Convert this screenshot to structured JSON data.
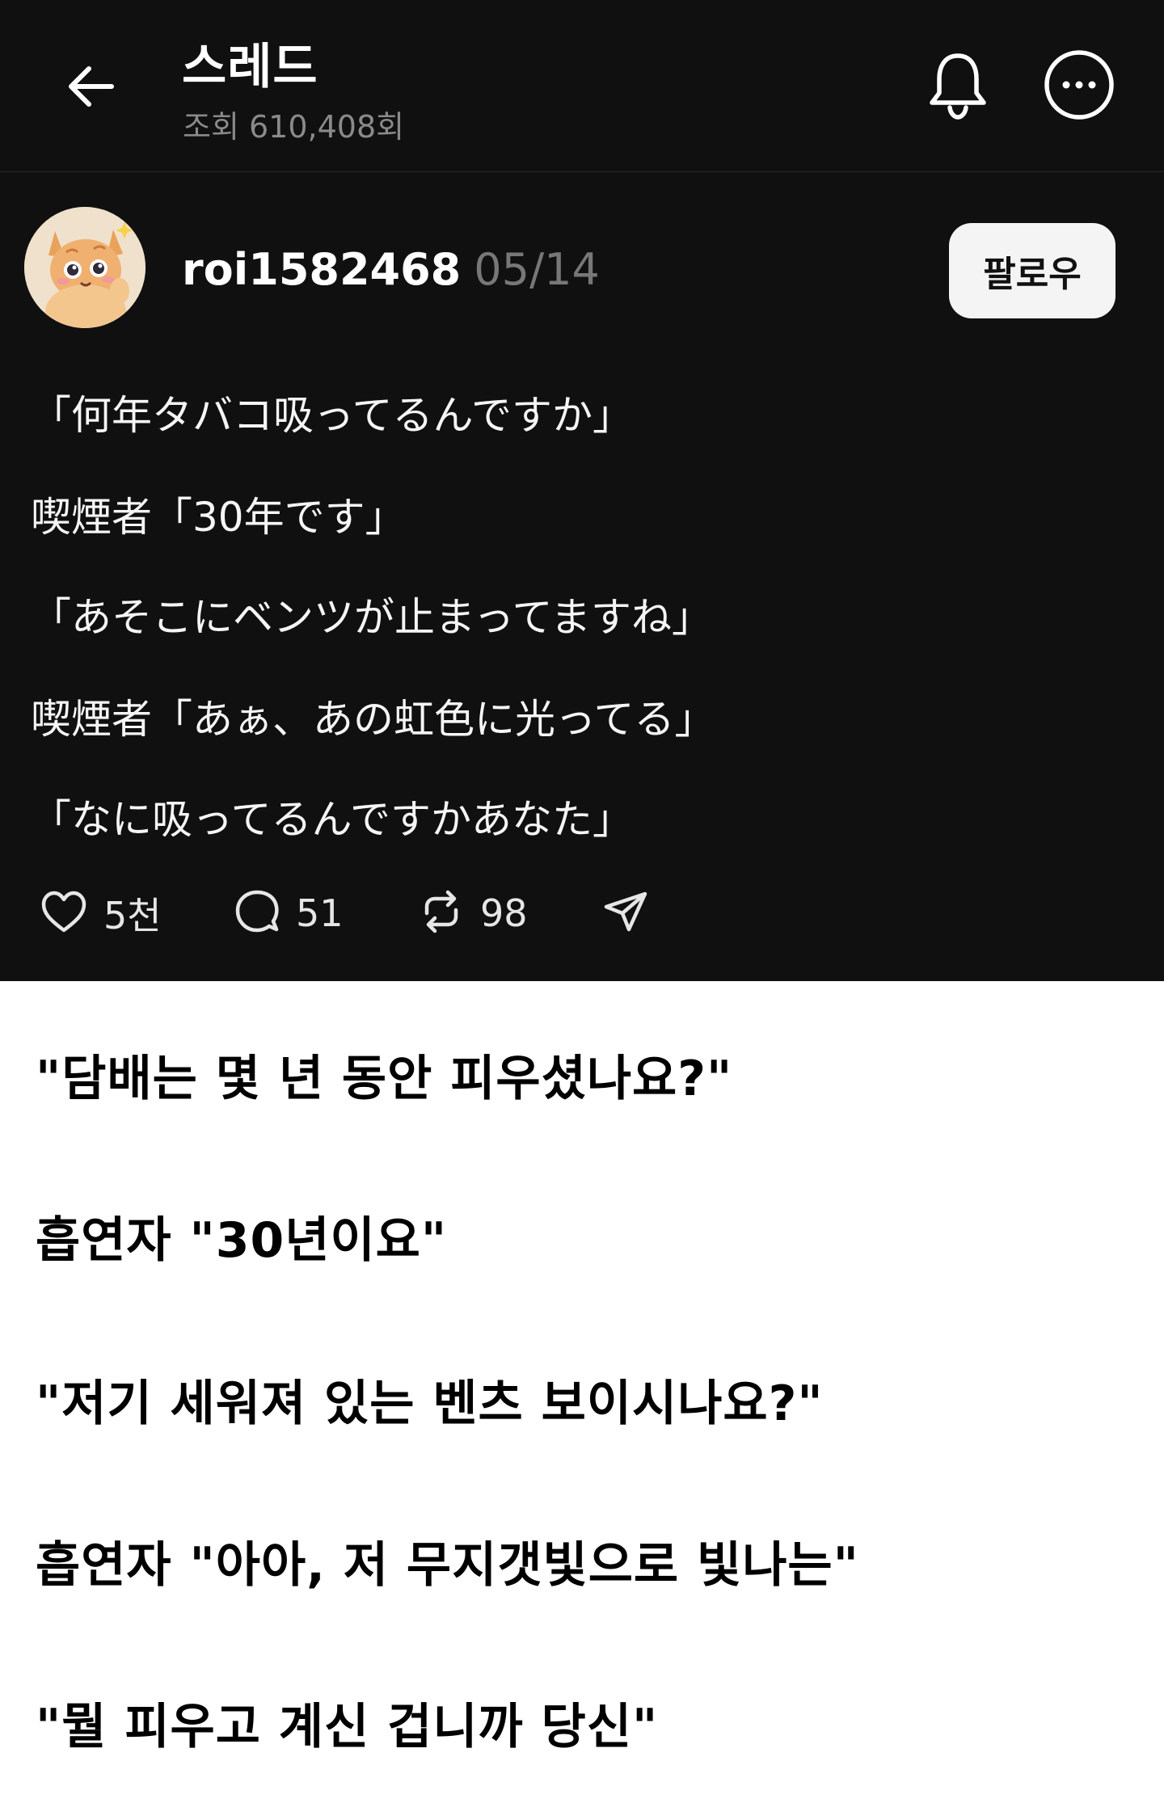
{
  "header": {
    "title": "스레드",
    "views": "조회 610,408회"
  },
  "icons": {
    "back": "back-arrow-icon",
    "bell": "bell-icon",
    "more": "more-options-icon",
    "like": "heart-icon",
    "comment": "comment-icon",
    "repost": "repost-icon",
    "share": "send-icon"
  },
  "post": {
    "author": "roi1582468",
    "date": "05/14",
    "follow_label": "팔로우",
    "lines": [
      "「何年タバコ吸ってるんですか」",
      "喫煙者「30年です」",
      "「あそこにベンツが止まってますね」",
      "喫煙者「あぁ、あの虹色に光ってる」",
      "「なに吸ってるんですかあなた」"
    ],
    "stats": {
      "likes": "5천",
      "comments": "51",
      "reposts": "98"
    }
  },
  "translation": {
    "lines": [
      "\"담배는 몇 년 동안 피우셨나요?\"",
      "흡연자 \"30년이요\"",
      "\"저기 세워져 있는 벤츠 보이시나요?\"",
      "흡연자 \"아아, 저 무지갯빛으로 빛나는\"",
      "\"뭘 피우고 계신 겁니까 당신\""
    ]
  },
  "colors": {
    "dark_bg": "#101010",
    "white_bg": "#ffffff",
    "muted_text": "#8a8a8a",
    "follow_bg": "#f4f4f5"
  }
}
